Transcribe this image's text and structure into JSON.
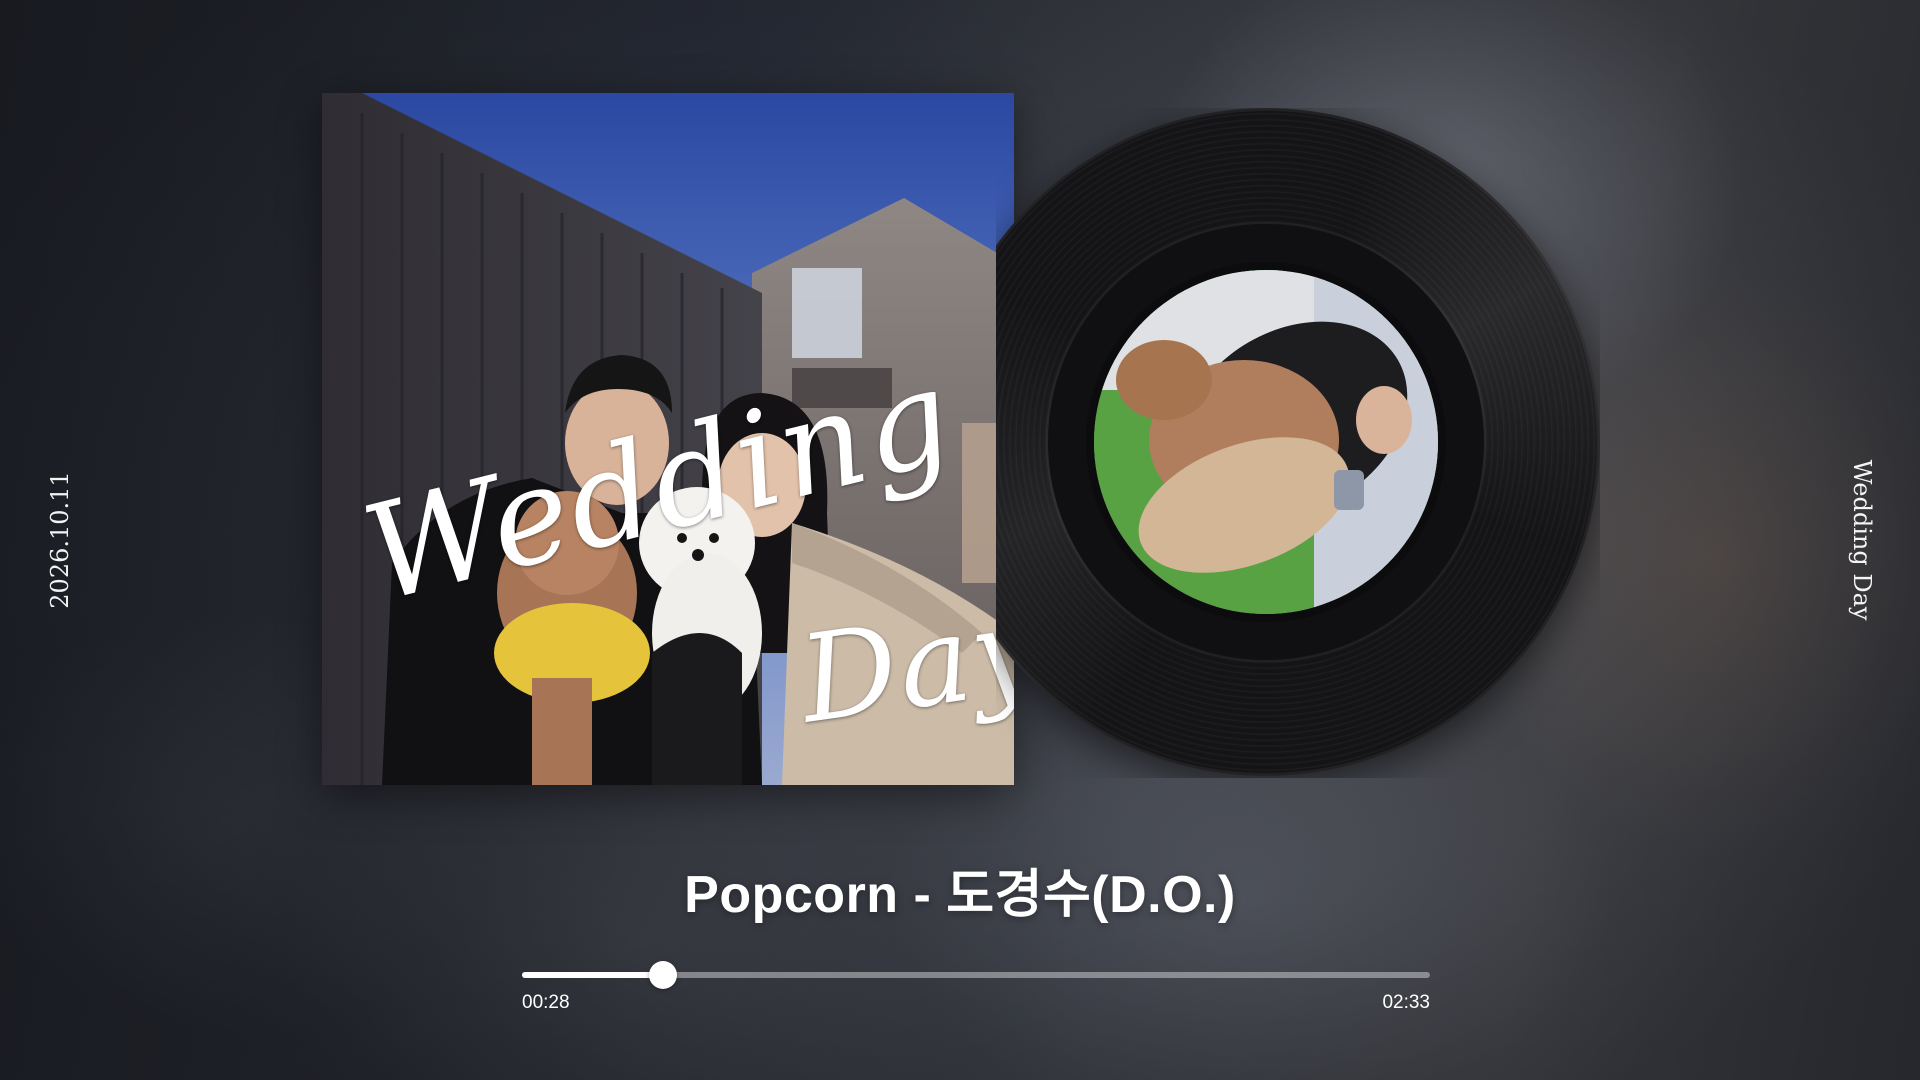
{
  "side_date": "2026.10.11",
  "side_title": "Wedding Day",
  "album": {
    "script_word_1": "Wedding",
    "script_word_2": "Day"
  },
  "player": {
    "song_title": "Popcorn - 도경수(D.O.)",
    "current_time": "00:28",
    "total_time": "02:33",
    "progress_fraction": 0.155
  }
}
